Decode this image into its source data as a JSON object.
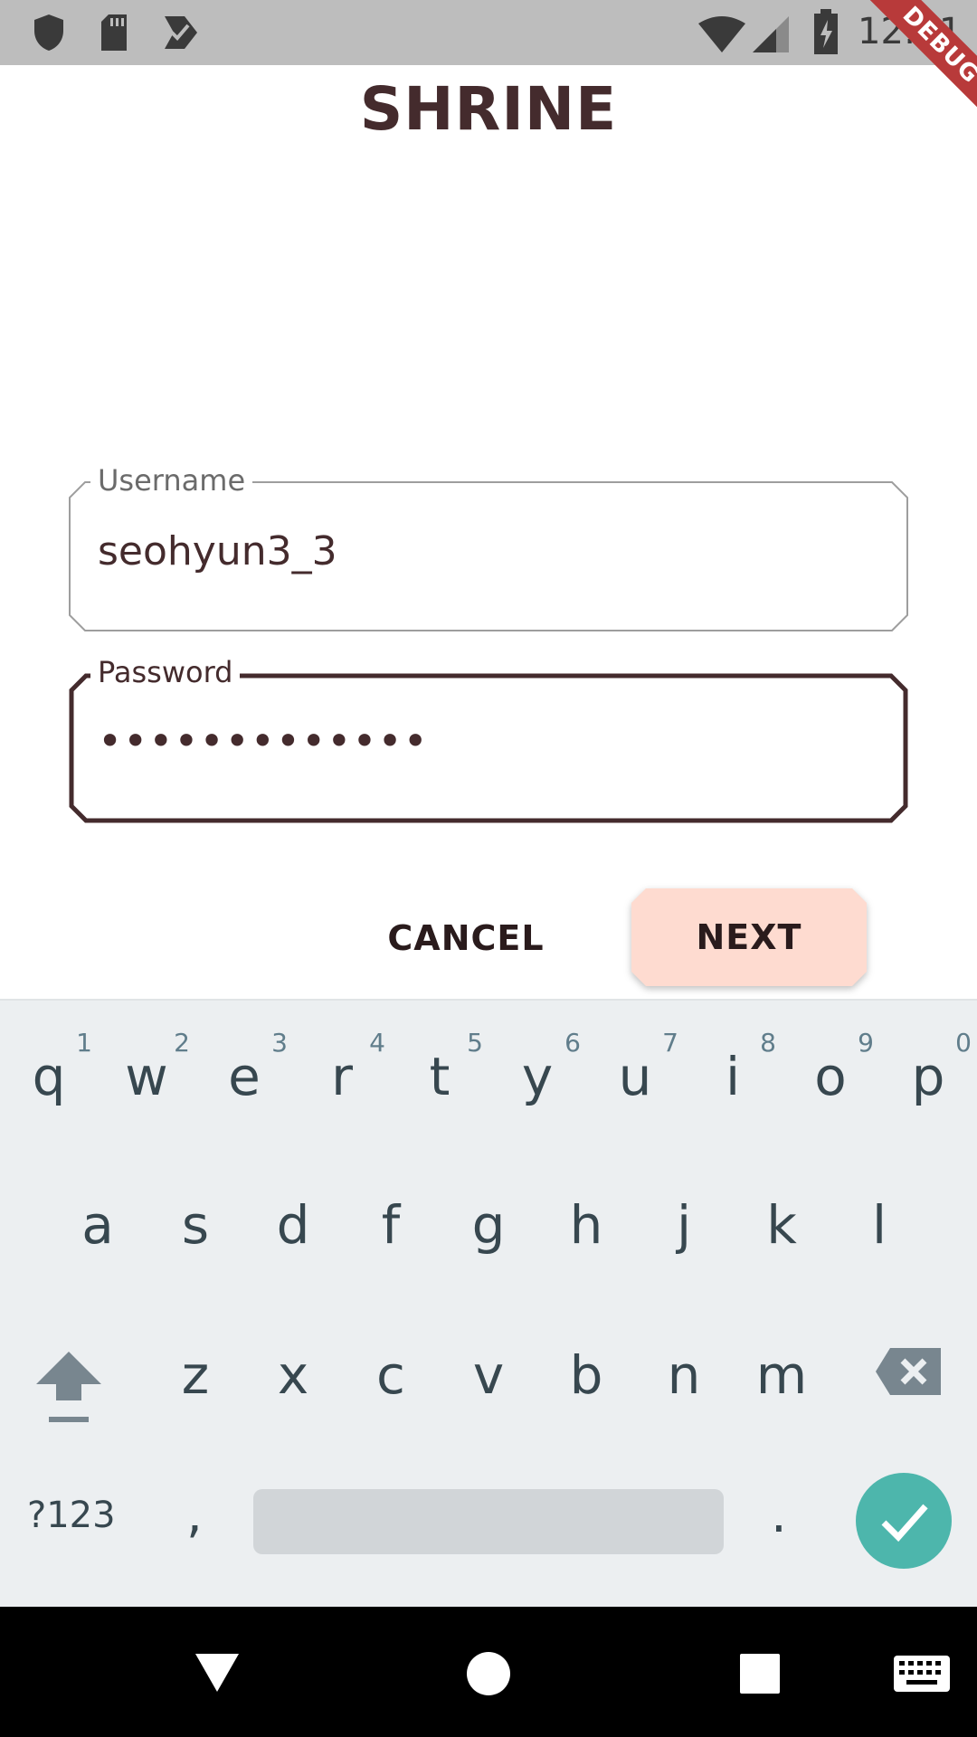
{
  "status_bar": {
    "time": "12:31",
    "left_icons": [
      "shield-icon",
      "sd-card-icon",
      "task-check-icon"
    ],
    "right_icons": [
      "wifi-icon",
      "cellular-signal-icon",
      "battery-charging-icon"
    ]
  },
  "debug_banner": "DEBUG",
  "app": {
    "title": "SHRINE",
    "username": {
      "label": "Username",
      "value": "seohyun3_3"
    },
    "password": {
      "label": "Password",
      "masked_value": "•••••••••••••"
    },
    "cancel_label": "CANCEL",
    "next_label": "NEXT",
    "colors": {
      "brown": "#442b2d",
      "pink": "#fedbd0"
    }
  },
  "keyboard": {
    "row1": [
      {
        "key": "q",
        "hint": "1"
      },
      {
        "key": "w",
        "hint": "2"
      },
      {
        "key": "e",
        "hint": "3"
      },
      {
        "key": "r",
        "hint": "4"
      },
      {
        "key": "t",
        "hint": "5"
      },
      {
        "key": "y",
        "hint": "6"
      },
      {
        "key": "u",
        "hint": "7"
      },
      {
        "key": "i",
        "hint": "8"
      },
      {
        "key": "o",
        "hint": "9"
      },
      {
        "key": "p",
        "hint": "0"
      }
    ],
    "row2": [
      "a",
      "s",
      "d",
      "f",
      "g",
      "h",
      "j",
      "k",
      "l"
    ],
    "row3": [
      "z",
      "x",
      "c",
      "v",
      "b",
      "n",
      "m"
    ],
    "symbols_label": "?123",
    "comma": ",",
    "period": ".",
    "accent_color": "#4db6ac"
  },
  "nav_bar": {
    "icons": [
      "back-icon",
      "home-icon",
      "recents-icon",
      "keyboard-switch-icon"
    ]
  }
}
